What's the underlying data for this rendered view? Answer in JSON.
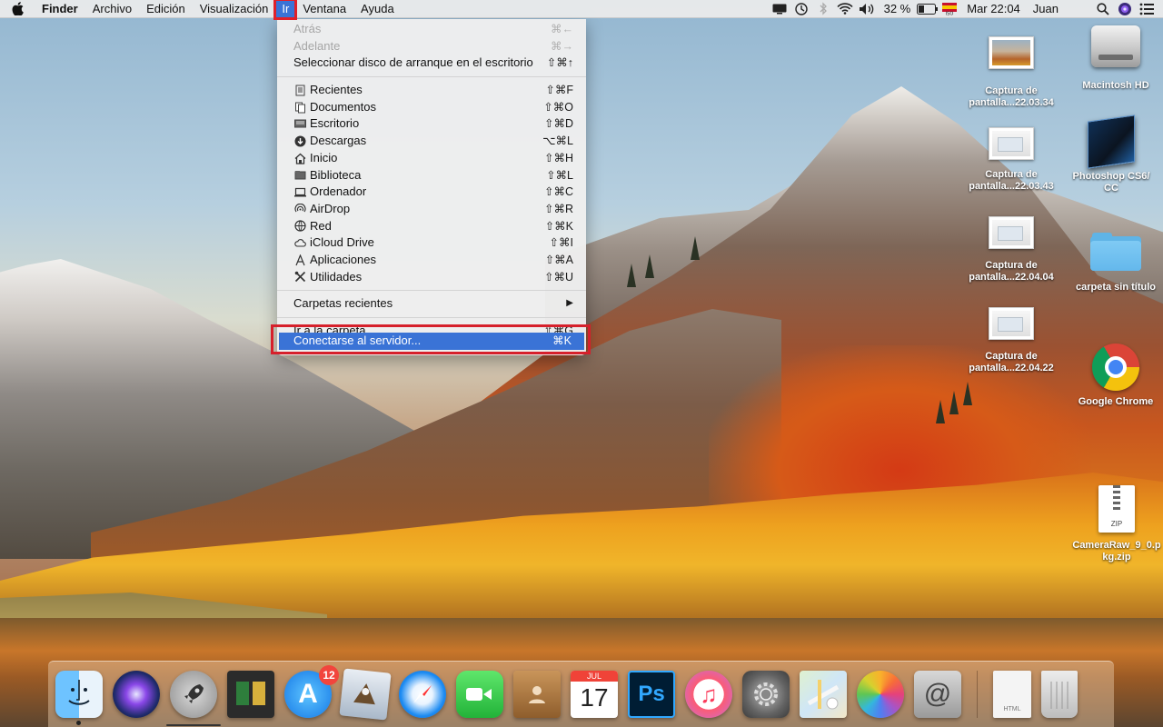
{
  "menubar": {
    "app_name": "Finder",
    "items": [
      "Archivo",
      "Edición",
      "Visualización",
      "Ir",
      "Ventana",
      "Ayuda"
    ],
    "active_item": "Ir",
    "status": {
      "battery": "32 %",
      "clock": "Mar 22:04",
      "user": "Juan"
    },
    "status_icons": [
      "display-icon",
      "time-machine-icon",
      "bluetooth-icon",
      "wifi-icon",
      "volume-icon",
      "battery-icon",
      "input-flag-icon",
      "spotlight-icon",
      "siri-icon",
      "notification-center-icon"
    ]
  },
  "go_menu": {
    "group1": [
      {
        "label": "Atrás",
        "shortcut": "⌘←",
        "disabled": true
      },
      {
        "label": "Adelante",
        "shortcut": "⌘→",
        "disabled": true
      },
      {
        "label": "Seleccionar disco de arranque en el escritorio",
        "shortcut": "⇧⌘↑",
        "disabled": false
      }
    ],
    "group2": [
      {
        "label": "Recientes",
        "shortcut": "⇧⌘F",
        "icon": "recents-icon"
      },
      {
        "label": "Documentos",
        "shortcut": "⇧⌘O",
        "icon": "documents-icon"
      },
      {
        "label": "Escritorio",
        "shortcut": "⇧⌘D",
        "icon": "desktop-icon"
      },
      {
        "label": "Descargas",
        "shortcut": "⌥⌘L",
        "icon": "downloads-icon"
      },
      {
        "label": "Inicio",
        "shortcut": "⇧⌘H",
        "icon": "home-icon"
      },
      {
        "label": "Biblioteca",
        "shortcut": "⇧⌘L",
        "icon": "library-icon"
      },
      {
        "label": "Ordenador",
        "shortcut": "⇧⌘C",
        "icon": "computer-icon"
      },
      {
        "label": "AirDrop",
        "shortcut": "⇧⌘R",
        "icon": "airdrop-icon"
      },
      {
        "label": "Red",
        "shortcut": "⇧⌘K",
        "icon": "network-icon"
      },
      {
        "label": "iCloud Drive",
        "shortcut": "⇧⌘I",
        "icon": "icloud-icon"
      },
      {
        "label": "Aplicaciones",
        "shortcut": "⇧⌘A",
        "icon": "applications-icon"
      },
      {
        "label": "Utilidades",
        "shortcut": "⇧⌘U",
        "icon": "utilities-icon"
      }
    ],
    "recent_folders": {
      "label": "Carpetas recientes",
      "arrow": "▶"
    },
    "go_to_folder": {
      "label": "Ir a la carpeta...",
      "shortcut": "⇧⌘G"
    },
    "connect_server": {
      "label": "Conectarse al servidor...",
      "shortcut": "⌘K",
      "highlighted": true
    }
  },
  "desktop_icons": [
    {
      "name": "screenshot-22.03.34",
      "label": "Captura de pantalla...22.03.34",
      "kind": "thumb-landscape"
    },
    {
      "name": "screenshot-22.03.43",
      "label": "Captura de pantalla...22.03.43",
      "kind": "thumb-window"
    },
    {
      "name": "screenshot-22.04.04",
      "label": "Captura de pantalla...22.04.04",
      "kind": "thumb-window"
    },
    {
      "name": "screenshot-22.04.22",
      "label": "Captura de pantalla...22.04.22",
      "kind": "thumb-window"
    },
    {
      "name": "macintosh-hd",
      "label": "Macintosh HD",
      "kind": "hard-disk"
    },
    {
      "name": "photoshop",
      "label": "Photoshop CS6/ CC",
      "kind": "photoshop-box"
    },
    {
      "name": "untitled-folder",
      "label": "carpeta sin título",
      "kind": "folder"
    },
    {
      "name": "google-chrome",
      "label": "Google Chrome",
      "kind": "chrome"
    },
    {
      "name": "cameraraw-zip",
      "label": "CameraRaw_9_0.pkg.zip",
      "kind": "zip",
      "badge_text": "ZIP"
    }
  ],
  "dock": {
    "apps": [
      "finder-icon",
      "siri-icon",
      "launchpad-icon",
      "mission-control-icon",
      "app-store-icon",
      "mail-icon",
      "safari-icon",
      "facetime-icon",
      "contacts-icon",
      "calendar-icon",
      "photoshop-icon",
      "itunes-icon",
      "system-preferences-icon",
      "maps-icon",
      "photos-icon",
      "mail-at-icon"
    ],
    "app_store_badge": "12",
    "calendar_month": "JUL",
    "calendar_day": "17",
    "photoshop_text": "Ps",
    "itunes_glyph": "♫",
    "app_store_glyph": "A",
    "at_glyph": "@",
    "doc_label": "HTML",
    "trailing": [
      "document-icon",
      "trash-icon"
    ]
  },
  "colors": {
    "accent": "#3a73d6",
    "annotation_red": "#d6202b"
  }
}
